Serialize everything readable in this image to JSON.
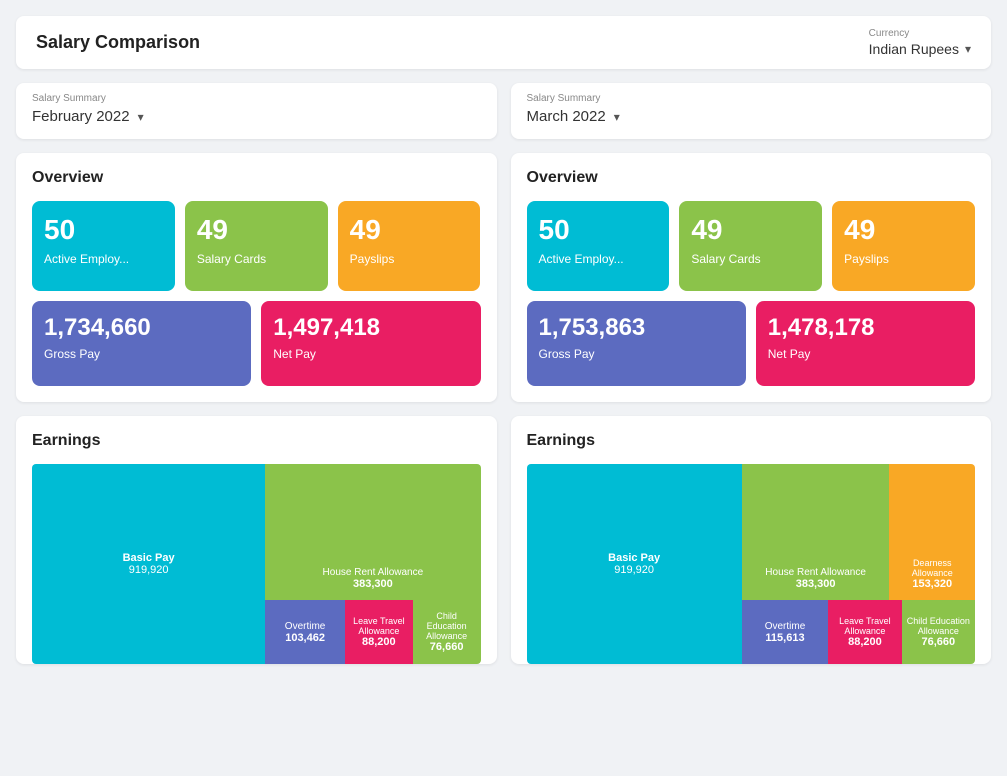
{
  "header": {
    "title": "Salary Comparison",
    "currency_label": "Currency",
    "currency_value": "Indian Rupees",
    "currency_arrow": "▾"
  },
  "left_panel": {
    "salary_summary_label": "Salary Summary",
    "salary_summary_value": "February 2022",
    "salary_summary_arrow": "▾",
    "overview_title": "Overview",
    "stats": {
      "active_employees": "50",
      "active_employees_label": "Active Employ...",
      "salary_cards": "49",
      "salary_cards_label": "Salary Cards",
      "payslips": "49",
      "payslips_label": "Payslips",
      "gross_pay": "1,734,660",
      "gross_pay_label": "Gross Pay",
      "net_pay": "1,497,418",
      "net_pay_label": "Net Pay"
    },
    "earnings_title": "Earnings",
    "earnings": {
      "basic_pay_label": "Basic Pay",
      "basic_pay_value": "919,920",
      "hra_label": "House Rent Allowance",
      "hra_value": "383,300",
      "overtime_label": "Overtime",
      "overtime_value": "103,462",
      "lta_label": "Leave Travel Allowance",
      "lta_value": "88,200",
      "cea_label": "Child Education Allowance",
      "cea_value": "76,660"
    }
  },
  "right_panel": {
    "salary_summary_label": "Salary Summary",
    "salary_summary_value": "March 2022",
    "salary_summary_arrow": "▾",
    "overview_title": "Overview",
    "stats": {
      "active_employees": "50",
      "active_employees_label": "Active Employ...",
      "salary_cards": "49",
      "salary_cards_label": "Salary Cards",
      "payslips": "49",
      "payslips_label": "Payslips",
      "gross_pay": "1,753,863",
      "gross_pay_label": "Gross Pay",
      "net_pay": "1,478,178",
      "net_pay_label": "Net Pay"
    },
    "earnings_title": "Earnings",
    "earnings": {
      "basic_pay_label": "Basic Pay",
      "basic_pay_value": "919,920",
      "hra_label": "House Rent Allowance",
      "hra_value": "383,300",
      "da_label": "Dearness Allowance",
      "da_value": "153,320",
      "overtime_label": "Overtime",
      "overtime_value": "115,613",
      "lta_label": "Leave Travel Allowance",
      "lta_value": "88,200",
      "cea_label": "Child Education Allowance",
      "cea_value": "76,660"
    }
  }
}
